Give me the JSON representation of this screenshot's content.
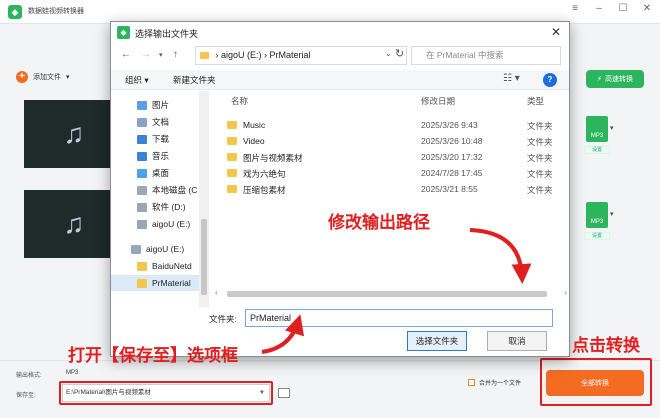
{
  "app": {
    "title": "数据蛙视频转换器",
    "add_file": "添加文件",
    "fast_convert": "高速转换",
    "format_label": "MP3",
    "format_sub": "设置",
    "output_format_label": "输出格式:",
    "output_format_value": "MP3",
    "save_to_label": "保存至:",
    "save_path": "E:\\PrMaterial\\图片与视频素材",
    "merge_label": "合并为一个文件",
    "convert_all": "全部转换"
  },
  "dialog": {
    "title": "选择输出文件夹",
    "address_drive": "aigoU (E:)",
    "address_folder": "PrMaterial",
    "search_placeholder": "在 PrMaterial 中搜索",
    "organize": "组织",
    "new_folder": "新建文件夹",
    "nav_items": [
      {
        "label": "图片",
        "icon": "pictures-icon",
        "color": "#5aa0e6"
      },
      {
        "label": "文档",
        "icon": "documents-icon",
        "color": "#8aa4c8"
      },
      {
        "label": "下载",
        "icon": "download-icon",
        "color": "#3b82d6"
      },
      {
        "label": "音乐",
        "icon": "music-icon",
        "color": "#3b82d6"
      },
      {
        "label": "桌面",
        "icon": "desktop-icon",
        "color": "#4aa3e8"
      },
      {
        "label": "本地磁盘 (C",
        "icon": "disk-icon",
        "color": "#9aa7b5"
      },
      {
        "label": "软件 (D:)",
        "icon": "disk-icon",
        "color": "#9aa7b5"
      },
      {
        "label": "aigoU (E:)",
        "icon": "disk-icon",
        "color": "#9aa7b5"
      },
      {
        "label": "aigoU (E:)",
        "icon": "drive-icon",
        "color": "#9aa7b5"
      },
      {
        "label": "BaiduNetd",
        "icon": "folder-icon",
        "color": "#f4c64e"
      },
      {
        "label": "PrMaterial",
        "icon": "folder-icon",
        "color": "#f4c64e"
      }
    ],
    "columns": {
      "name": "名称",
      "date": "修改日期",
      "type": "类型"
    },
    "rows": [
      {
        "name": "Music",
        "date": "2025/3/26 9:43",
        "type": "文件夹"
      },
      {
        "name": "Video",
        "date": "2025/3/26 10:48",
        "type": "文件夹"
      },
      {
        "name": "图片与视频素材",
        "date": "2025/3/20 17:32",
        "type": "文件夹"
      },
      {
        "name": "戏为六绝句",
        "date": "2024/7/28 17:45",
        "type": "文件夹"
      },
      {
        "name": "压缩包素材",
        "date": "2025/3/21 8:55",
        "type": "文件夹"
      }
    ],
    "folder_label": "文件夹:",
    "folder_value": "PrMaterial",
    "select_button": "选择文件夹",
    "cancel_button": "取消"
  },
  "annotations": {
    "modify_path": "修改输出路径",
    "open_save": "打开【保存至】选项框",
    "click_convert": "点击转换"
  },
  "colors": {
    "accent_green": "#2db55d",
    "accent_orange": "#f36c21",
    "annotation_red": "#e02020"
  }
}
